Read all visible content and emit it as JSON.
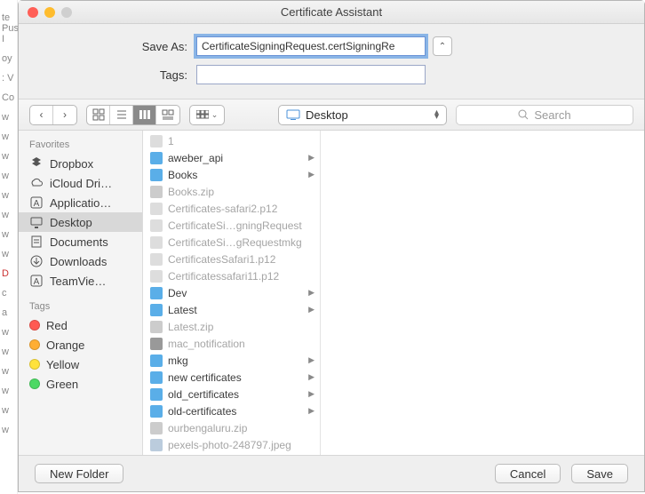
{
  "window": {
    "title": "Certificate Assistant",
    "bg_hint": "te Push I"
  },
  "form": {
    "save_as_label": "Save As:",
    "save_as_value": "CertificateSigningRequest.certSigningRe",
    "tags_label": "Tags:",
    "tags_value": ""
  },
  "toolbar": {
    "location": "Desktop",
    "search_placeholder": "Search"
  },
  "sidebar": {
    "favorites_header": "Favorites",
    "favorites": [
      {
        "label": "Dropbox",
        "icon": "dropbox"
      },
      {
        "label": "iCloud Dri…",
        "icon": "cloud"
      },
      {
        "label": "Applicatio…",
        "icon": "app"
      },
      {
        "label": "Desktop",
        "icon": "desktop",
        "selected": true
      },
      {
        "label": "Documents",
        "icon": "doc"
      },
      {
        "label": "Downloads",
        "icon": "down"
      },
      {
        "label": "TeamVie…",
        "icon": "app"
      }
    ],
    "tags_header": "Tags",
    "tags": [
      {
        "label": "Red",
        "color": "red"
      },
      {
        "label": "Orange",
        "color": "orange"
      },
      {
        "label": "Yellow",
        "color": "yellow"
      },
      {
        "label": "Green",
        "color": "green"
      }
    ]
  },
  "files": [
    {
      "name": "1",
      "type": "file",
      "dim": true
    },
    {
      "name": "aweber_api",
      "type": "folder",
      "expand": true
    },
    {
      "name": "Books",
      "type": "folder",
      "expand": true
    },
    {
      "name": "Books.zip",
      "type": "zip",
      "dim": true
    },
    {
      "name": "Certificates-safari2.p12",
      "type": "file",
      "dim": true
    },
    {
      "name": "CertificateSi…gningRequest",
      "type": "file",
      "dim": true
    },
    {
      "name": "CertificateSi…gRequestmkg",
      "type": "file",
      "dim": true
    },
    {
      "name": "CertificatesSafari1.p12",
      "type": "file",
      "dim": true
    },
    {
      "name": "Certificatessafari11.p12",
      "type": "file",
      "dim": true
    },
    {
      "name": "Dev",
      "type": "folder",
      "expand": true
    },
    {
      "name": "Latest",
      "type": "folder",
      "expand": true
    },
    {
      "name": "Latest.zip",
      "type": "zip",
      "dim": true
    },
    {
      "name": "mac_notification",
      "type": "exe",
      "dim": true
    },
    {
      "name": "mkg",
      "type": "folder",
      "expand": true
    },
    {
      "name": "new certificates",
      "type": "folder",
      "expand": true
    },
    {
      "name": "old_certificates",
      "type": "folder",
      "expand": true
    },
    {
      "name": "old-certificates",
      "type": "folder",
      "expand": true
    },
    {
      "name": "ourbengaluru.zip",
      "type": "zip",
      "dim": true
    },
    {
      "name": "pexels-photo-248797.jpeg",
      "type": "img",
      "dim": true
    }
  ],
  "footer": {
    "new_folder": "New Folder",
    "cancel": "Cancel",
    "save": "Save"
  }
}
